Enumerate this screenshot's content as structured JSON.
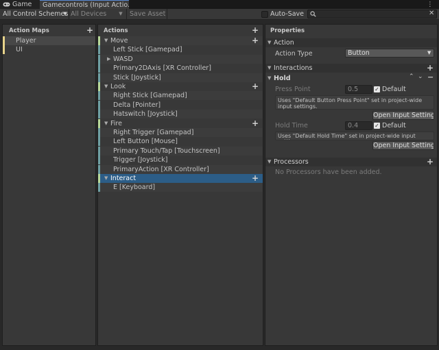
{
  "tabs": [
    {
      "label": "Game",
      "icon": "gamepad-icon"
    },
    {
      "label": "Gamecontrols (Input Actio...",
      "icon": ""
    }
  ],
  "tab_menu_icon": "⋮",
  "toolbar": {
    "control_schemes": "All Control Schemes",
    "devices": "All Devices",
    "save_asset": "Save Asset",
    "auto_save": "Auto-Save",
    "auto_save_checked": false,
    "search_placeholder": ""
  },
  "action_maps": {
    "header": "Action Maps",
    "items": [
      {
        "label": "Player",
        "selected": true
      },
      {
        "label": "UI",
        "selected": false
      }
    ]
  },
  "actions": {
    "header": "Actions",
    "rows": [
      {
        "label": "Move",
        "kind": "action",
        "expanded": true
      },
      {
        "label": "Left Stick [Gamepad]",
        "kind": "binding"
      },
      {
        "label": "WASD",
        "kind": "composite",
        "expanded": false
      },
      {
        "label": "Primary2DAxis [XR Controller]",
        "kind": "binding"
      },
      {
        "label": "Stick [Joystick]",
        "kind": "binding"
      },
      {
        "label": "Look",
        "kind": "action",
        "expanded": true
      },
      {
        "label": "Right Stick [Gamepad]",
        "kind": "binding"
      },
      {
        "label": "Delta [Pointer]",
        "kind": "binding"
      },
      {
        "label": "Hatswitch [Joystick]",
        "kind": "binding"
      },
      {
        "label": "Fire",
        "kind": "action",
        "expanded": true
      },
      {
        "label": "Right Trigger [Gamepad]",
        "kind": "binding"
      },
      {
        "label": "Left Button [Mouse]",
        "kind": "binding"
      },
      {
        "label": "Primary Touch/Tap [Touchscreen]",
        "kind": "binding"
      },
      {
        "label": "Trigger [Joystick]",
        "kind": "binding"
      },
      {
        "label": "PrimaryAction [XR Controller]",
        "kind": "binding"
      },
      {
        "label": "Interact",
        "kind": "action",
        "expanded": true,
        "selected": true
      },
      {
        "label": "E [Keyboard]",
        "kind": "binding"
      }
    ]
  },
  "properties": {
    "header": "Properties",
    "action_section": "Action",
    "action_type_label": "Action Type",
    "action_type_value": "Button",
    "interactions_section": "Interactions",
    "hold_label": "Hold",
    "press_point_label": "Press Point",
    "press_point_value": "0.5",
    "default_label": "Default",
    "press_help": "Uses \"Default Button Press Point\" set in project-wide input settings.",
    "open_settings": "Open Input Settings",
    "hold_time_label": "Hold Time",
    "hold_time_value": "0.4",
    "hold_help": "Uses \"Default Hold Time\" set in project-wide input settings.",
    "processors_section": "Processors",
    "no_processors": "No Processors have been added."
  },
  "colors": {
    "action_bar": "#b8d99a",
    "binding_bar": "#6fa0a3",
    "map_bar": "#e7d38a",
    "selection": "#2c5d87",
    "tab_accent": "#5a8bd6"
  }
}
